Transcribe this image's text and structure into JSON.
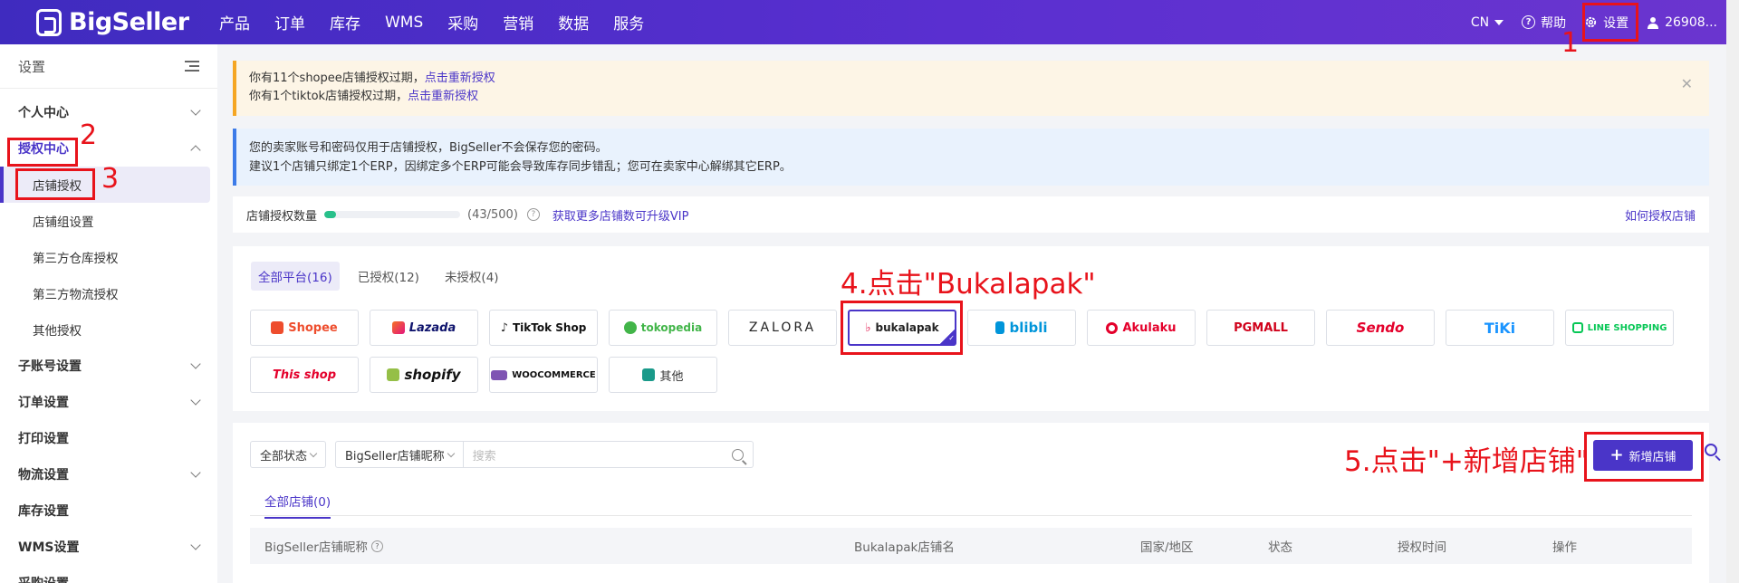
{
  "brand": {
    "name": "BigSeller"
  },
  "topnav": [
    "产品",
    "订单",
    "库存",
    "WMS",
    "采购",
    "营销",
    "数据",
    "服务"
  ],
  "topright": {
    "lang": "CN",
    "help": "帮助",
    "settings": "设置",
    "user": "26908..."
  },
  "sidebar": {
    "title": "设置",
    "items": [
      {
        "label": "个人中心"
      },
      {
        "label": "授权中心"
      },
      {
        "sub": [
          "店铺授权",
          "店铺组设置",
          "第三方仓库授权",
          "第三方物流授权",
          "其他授权"
        ]
      },
      {
        "label": "子账号设置"
      },
      {
        "label": "订单设置"
      },
      {
        "label": "打印设置"
      },
      {
        "label": "物流设置"
      },
      {
        "label": "库存设置"
      },
      {
        "label": "WMS设置"
      },
      {
        "label": "采购设置"
      }
    ]
  },
  "alerts": {
    "warn_line1": "你有11个shopee店铺授权过期，",
    "warn_link1": "点击重新授权",
    "warn_line2": "你有1个tiktok店铺授权过期，",
    "warn_link2": "点击重新授权",
    "info_line1": "您的卖家账号和密码仅用于店铺授权，BigSeller不会保存您的密码。",
    "info_line2": "建议1个店铺只绑定1个ERP，因绑定多个ERP可能会导致库存同步错乱；您可在卖家中心解绑其它ERP。"
  },
  "quota": {
    "label": "店铺授权数量",
    "count": "(43/500)",
    "used": 43,
    "total": 500,
    "upgrade_link": "获取更多店铺数可升级VIP",
    "howto_link": "如何授权店铺"
  },
  "platform_tabs": [
    "全部平台(16)",
    "已授权(12)",
    "未授权(4)"
  ],
  "platforms": [
    "Shopee",
    "Lazada",
    "TikTok Shop",
    "tokopedia",
    "ZALORA",
    "bukalapak",
    "blibli",
    "Akulaku",
    "PGMALL",
    "Sendo",
    "TiKi",
    "LINE SHOPPING",
    "This shop",
    "shopify",
    "WOOCOMMERCE",
    "其他"
  ],
  "selected_platform": "bukalapak",
  "stores": {
    "status_select": "全部状态",
    "nickname_select": "BigSeller店铺昵称",
    "search_placeholder": "搜索",
    "add_button": "新增店铺",
    "tab": "全部店铺(0)",
    "columns": [
      "BigSeller店铺昵称",
      "Bukalapak店铺名",
      "国家/地区",
      "状态",
      "授权时间",
      "操作"
    ]
  },
  "annotations": {
    "n1": "1",
    "n2": "2",
    "n3": "3",
    "step4": "4.点击\"Bukalapak\"",
    "step5": "5.点击\"+新增店铺\""
  },
  "colors": {
    "accent": "#4a35c8",
    "annotation": "#e8131b",
    "warn": "#f5a623",
    "info": "#3d7be8",
    "progress": "#28c08a"
  }
}
